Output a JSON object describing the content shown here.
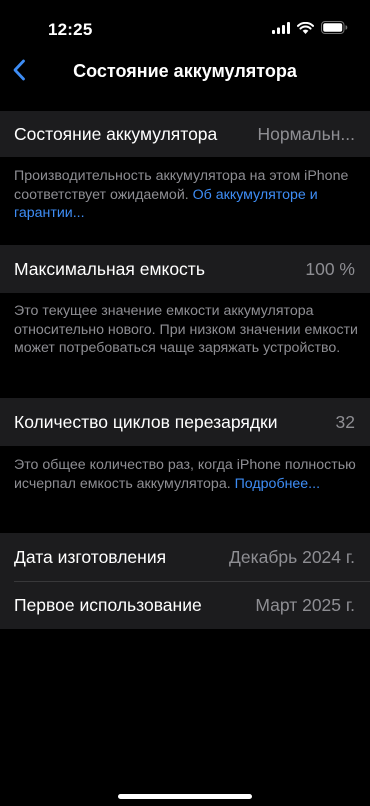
{
  "status_bar": {
    "time": "12:25"
  },
  "nav": {
    "title": "Состояние аккумулятора"
  },
  "battery_health": {
    "label": "Состояние аккумулятора",
    "value": "Нормальн...",
    "footer_text": "Производительность аккумулятора на этом iPhone соответствует ожидаемой. ",
    "footer_link": "Об аккумуляторе и гарантии..."
  },
  "max_capacity": {
    "label": "Максимальная емкость",
    "value": "100 %",
    "footer_text": "Это текущее значение емкости аккумулятора относительно нового. При низком значении емкости может потребоваться чаще заряжать устройство."
  },
  "cycle_count": {
    "label": "Количество циклов перезарядки",
    "value": "32",
    "footer_text": "Это общее количество раз, когда iPhone полностью исчерпал емкость аккумулятора. ",
    "footer_link": "Подробнее..."
  },
  "dates": {
    "manufacture_label": "Дата изготовления",
    "manufacture_value": "Декабрь 2024 г.",
    "first_use_label": "Первое использование",
    "first_use_value": "Март 2025 г."
  },
  "colors": {
    "accent": "#3e8df5",
    "secondary_text": "#8e8e93",
    "cell_background": "#1c1c1e"
  }
}
